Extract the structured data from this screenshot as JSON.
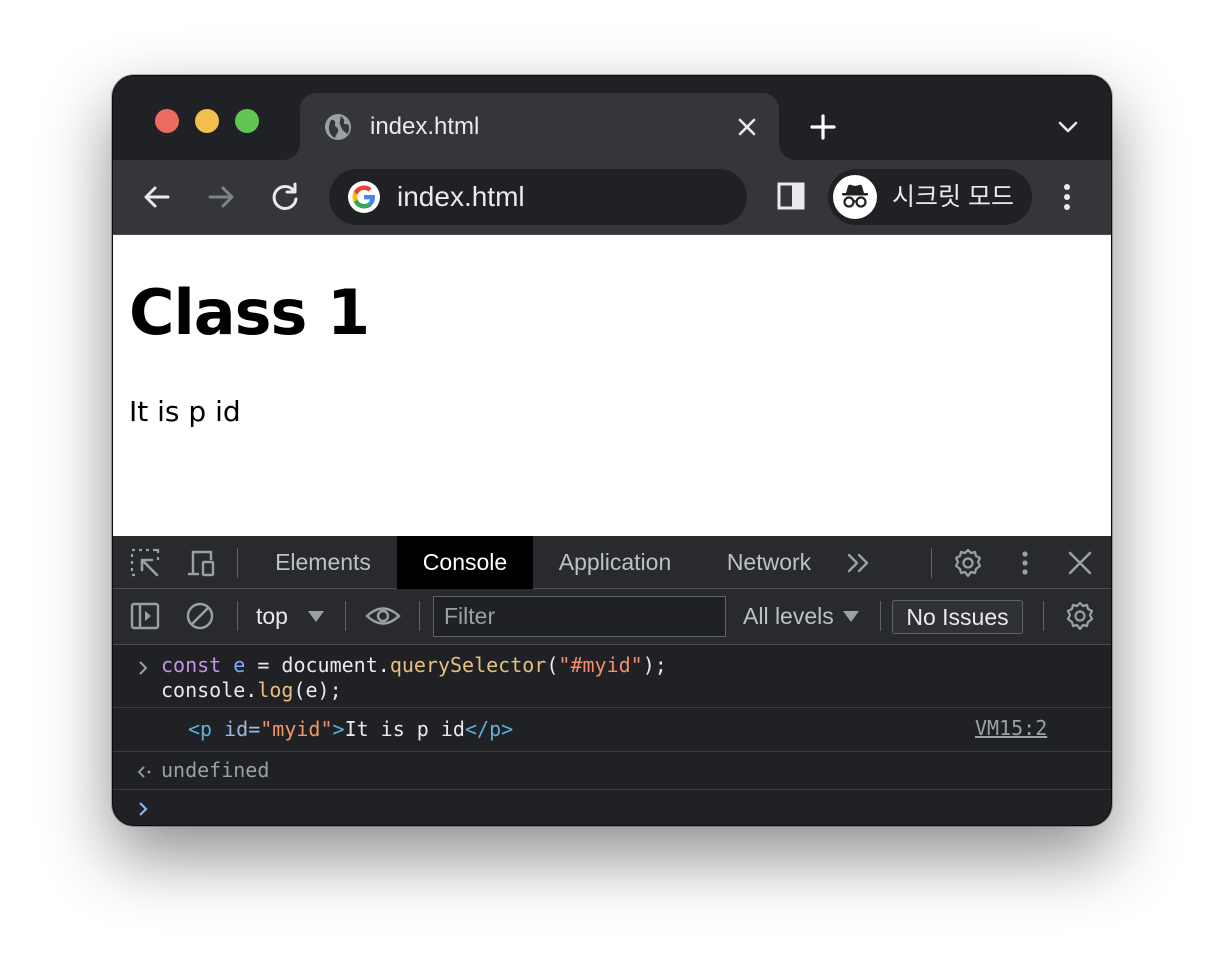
{
  "browser": {
    "tab": {
      "title": "index.html"
    },
    "address_bar": {
      "url": "index.html"
    },
    "profile": {
      "label": "시크릿 모드"
    }
  },
  "page": {
    "heading": "Class 1",
    "paragraph": "It is p id"
  },
  "devtools": {
    "tabs": [
      "Elements",
      "Console",
      "Application",
      "Network"
    ],
    "active_tab": "Console",
    "console_toolbar": {
      "context": "top",
      "filter_placeholder": "Filter",
      "levels": "All levels",
      "issues": "No Issues"
    },
    "console": {
      "input_line_1": {
        "kw": "const",
        "var": "e",
        "eq": " = document.",
        "fn": "querySelector",
        "open": "(",
        "str": "\"#myid\"",
        "close": ");"
      },
      "input_line_2": {
        "obj": "console.",
        "fn": "log",
        "args": "(e);"
      },
      "output": {
        "tag_open": "<p",
        "attr": " id=",
        "attr_value": "\"myid\"",
        "tag_end": ">",
        "text": "It is p id",
        "tag_close": "</p>",
        "source": "VM15:2"
      },
      "result": "undefined"
    }
  }
}
